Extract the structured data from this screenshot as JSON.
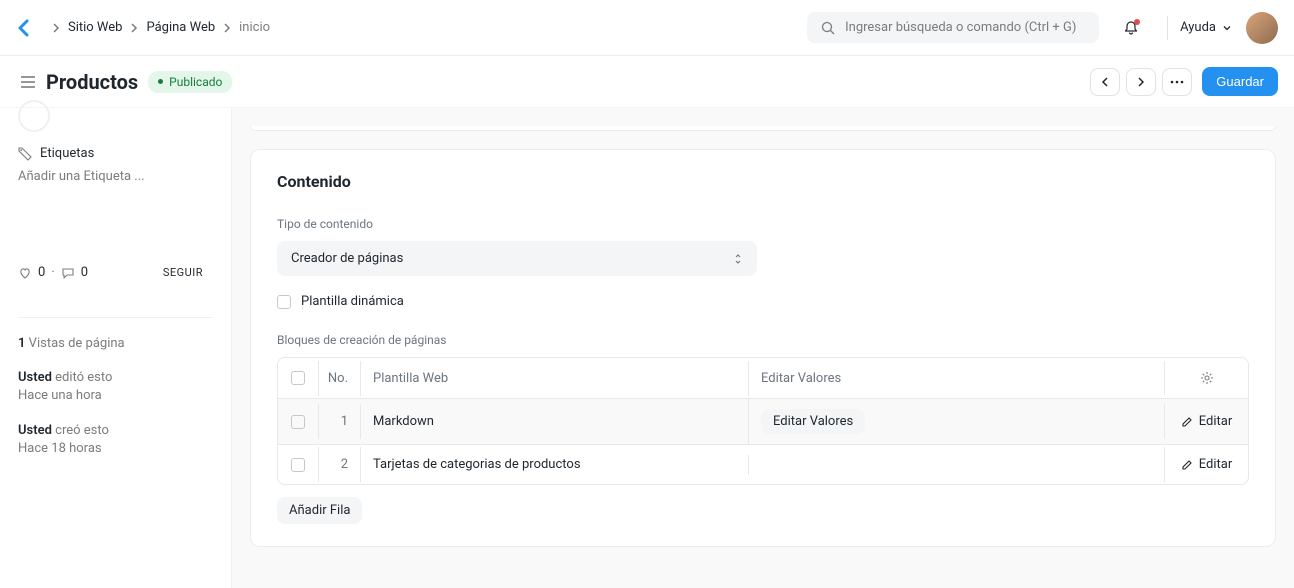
{
  "breadcrumb": [
    "Sitio Web",
    "Página Web",
    "inicio"
  ],
  "search": {
    "placeholder": "Ingresar búsqueda o comando (Ctrl + G)"
  },
  "help_label": "Ayuda",
  "toolbar": {
    "title": "Productos",
    "status": "Publicado",
    "save": "Guardar"
  },
  "sidebar": {
    "tags_label": "Etiquetas",
    "add_tag_placeholder": "Añadir una Etiqueta ...",
    "likes": "0",
    "comments": "0",
    "follow": "SEGUIR",
    "pageviews_count": "1",
    "pageviews_label": "Vistas de página",
    "activity": [
      {
        "who": "Usted",
        "what": "editó esto",
        "when": "Hace una hora"
      },
      {
        "who": "Usted",
        "what": "creó esto",
        "when": "Hace 18 horas"
      }
    ]
  },
  "content": {
    "heading": "Contenido",
    "type_label": "Tipo de contenido",
    "type_value": "Creador de páginas",
    "dynamic_label": "Plantilla dinámica",
    "blocks_label": "Bloques de creación de páginas",
    "columns": {
      "no": "No.",
      "template": "Plantilla Web",
      "edit_values": "Editar Valores"
    },
    "rows": [
      {
        "no": "1",
        "template": "Markdown",
        "edit_values_btn": "Editar Valores",
        "edit": "Editar"
      },
      {
        "no": "2",
        "template": "Tarjetas de categorias de productos",
        "edit_values_btn": "",
        "edit": "Editar"
      }
    ],
    "add_row": "Añadir Fila"
  }
}
